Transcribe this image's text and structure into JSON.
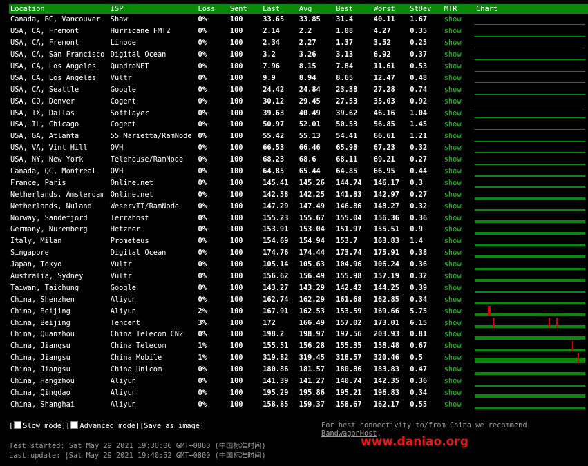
{
  "header": {
    "location": "Location",
    "isp": "ISP",
    "loss": "Loss",
    "sent": "Sent",
    "last": "Last",
    "avg": "Avg",
    "best": "Best",
    "worst": "Worst",
    "stdev": "StDev",
    "mtr": "MTR",
    "chart": "Chart"
  },
  "colors": {
    "header_bg": "#0a8a0a",
    "chart_green": "#0a8a0a",
    "spike_red": "#e00000",
    "link_green": "#1ec81e",
    "watermark": "#e81818"
  },
  "rows": [
    {
      "location": "Canada, BC, Vancouver",
      "isp": "Shaw",
      "loss": "0%",
      "sent": "100",
      "last": "33.65",
      "avg": "33.85",
      "best": "31.4",
      "worst": "40.11",
      "stdev": "1.67",
      "mtr": "show",
      "chart_level": 0.05,
      "spikes": []
    },
    {
      "location": "USA, CA, Fremont",
      "isp": "Hurricane FMT2",
      "loss": "0%",
      "sent": "100",
      "last": "2.14",
      "avg": "2.2",
      "best": "1.08",
      "worst": "4.27",
      "stdev": "0.35",
      "mtr": "show",
      "chart_level": 0.02,
      "spikes": []
    },
    {
      "location": "USA, CA, Fremont",
      "isp": "Linode",
      "loss": "0%",
      "sent": "100",
      "last": "2.34",
      "avg": "2.27",
      "best": "1.37",
      "worst": "3.52",
      "stdev": "0.25",
      "mtr": "show",
      "chart_level": 0.02,
      "spikes": []
    },
    {
      "location": "USA, CA, San Francisco",
      "isp": "Digital Ocean",
      "loss": "0%",
      "sent": "100",
      "last": "3.2",
      "avg": "3.26",
      "best": "3.13",
      "worst": "6.92",
      "stdev": "0.37",
      "mtr": "show",
      "chart_level": 0.02,
      "spikes": []
    },
    {
      "location": "USA, CA, Los Angeles",
      "isp": "QuadraNET",
      "loss": "0%",
      "sent": "100",
      "last": "7.96",
      "avg": "8.15",
      "best": "7.84",
      "worst": "11.61",
      "stdev": "0.53",
      "mtr": "show",
      "chart_level": 0.03,
      "spikes": []
    },
    {
      "location": "USA, CA, Los Angeles",
      "isp": "Vultr",
      "loss": "0%",
      "sent": "100",
      "last": "9.9",
      "avg": "8.94",
      "best": "8.65",
      "worst": "12.47",
      "stdev": "0.48",
      "mtr": "show",
      "chart_level": 0.03,
      "spikes": []
    },
    {
      "location": "USA, CA, Seattle",
      "isp": "Google",
      "loss": "0%",
      "sent": "100",
      "last": "24.42",
      "avg": "24.84",
      "best": "23.38",
      "worst": "27.28",
      "stdev": "0.74",
      "mtr": "show",
      "chart_level": 0.05,
      "spikes": []
    },
    {
      "location": "USA, CO, Denver",
      "isp": "Cogent",
      "loss": "0%",
      "sent": "100",
      "last": "30.12",
      "avg": "29.45",
      "best": "27.53",
      "worst": "35.03",
      "stdev": "0.92",
      "mtr": "show",
      "chart_level": 0.06,
      "spikes": []
    },
    {
      "location": "USA, TX, Dallas",
      "isp": "Softlayer",
      "loss": "0%",
      "sent": "100",
      "last": "39.63",
      "avg": "40.49",
      "best": "39.62",
      "worst": "46.16",
      "stdev": "1.04",
      "mtr": "show",
      "chart_level": 0.08,
      "spikes": []
    },
    {
      "location": "USA, IL, Chicago",
      "isp": "Cogent",
      "loss": "0%",
      "sent": "100",
      "last": "50.97",
      "avg": "52.01",
      "best": "50.53",
      "worst": "56.85",
      "stdev": "1.45",
      "mtr": "show",
      "chart_level": 0.1,
      "spikes": []
    },
    {
      "location": "USA, GA, Atlanta",
      "isp": "55 Marietta/RamNode",
      "loss": "0%",
      "sent": "100",
      "last": "55.42",
      "avg": "55.13",
      "best": "54.41",
      "worst": "66.61",
      "stdev": "1.21",
      "mtr": "show",
      "chart_level": 0.11,
      "spikes": []
    },
    {
      "location": "USA, VA, Vint Hill",
      "isp": "OVH",
      "loss": "0%",
      "sent": "100",
      "last": "66.53",
      "avg": "66.46",
      "best": "65.98",
      "worst": "67.23",
      "stdev": "0.32",
      "mtr": "show",
      "chart_level": 0.13,
      "spikes": []
    },
    {
      "location": "USA, NY, New York",
      "isp": "Telehouse/RamNode",
      "loss": "0%",
      "sent": "100",
      "last": "68.23",
      "avg": "68.6",
      "best": "68.11",
      "worst": "69.21",
      "stdev": "0.27",
      "mtr": "show",
      "chart_level": 0.14,
      "spikes": []
    },
    {
      "location": "Canada, QC, Montreal",
      "isp": "OVH",
      "loss": "0%",
      "sent": "100",
      "last": "64.85",
      "avg": "65.44",
      "best": "64.85",
      "worst": "66.95",
      "stdev": "0.44",
      "mtr": "show",
      "chart_level": 0.13,
      "spikes": []
    },
    {
      "location": "France, Paris",
      "isp": "Online.net",
      "loss": "0%",
      "sent": "100",
      "last": "145.41",
      "avg": "145.26",
      "best": "144.74",
      "worst": "146.17",
      "stdev": "0.3",
      "mtr": "show",
      "chart_level": 0.29,
      "spikes": []
    },
    {
      "location": "Netherlands, Amsterdam",
      "isp": "Online.net",
      "loss": "0%",
      "sent": "100",
      "last": "142.58",
      "avg": "142.25",
      "best": "141.83",
      "worst": "142.97",
      "stdev": "0.27",
      "mtr": "show",
      "chart_level": 0.28,
      "spikes": []
    },
    {
      "location": "Netherlands, Nuland",
      "isp": "WeservIT/RamNode",
      "loss": "0%",
      "sent": "100",
      "last": "147.29",
      "avg": "147.49",
      "best": "146.86",
      "worst": "148.27",
      "stdev": "0.32",
      "mtr": "show",
      "chart_level": 0.29,
      "spikes": []
    },
    {
      "location": "Norway, Sandefjord",
      "isp": "Terrahost",
      "loss": "0%",
      "sent": "100",
      "last": "155.23",
      "avg": "155.67",
      "best": "155.04",
      "worst": "156.36",
      "stdev": "0.36",
      "mtr": "show",
      "chart_level": 0.31,
      "spikes": []
    },
    {
      "location": "Germany, Nuremberg",
      "isp": "Hetzner",
      "loss": "0%",
      "sent": "100",
      "last": "153.91",
      "avg": "153.04",
      "best": "151.97",
      "worst": "155.51",
      "stdev": "0.9",
      "mtr": "show",
      "chart_level": 0.3,
      "spikes": []
    },
    {
      "location": "Italy, Milan",
      "isp": "Prometeus",
      "loss": "0%",
      "sent": "100",
      "last": "154.69",
      "avg": "154.94",
      "best": "153.7",
      "worst": "163.83",
      "stdev": "1.4",
      "mtr": "show",
      "chart_level": 0.31,
      "spikes": []
    },
    {
      "location": "Singapore",
      "isp": "Digital Ocean",
      "loss": "0%",
      "sent": "100",
      "last": "174.76",
      "avg": "174.44",
      "best": "173.74",
      "worst": "175.91",
      "stdev": "0.38",
      "mtr": "show",
      "chart_level": 0.35,
      "spikes": []
    },
    {
      "location": "Japan, Tokyo",
      "isp": "Vultr",
      "loss": "0%",
      "sent": "100",
      "last": "105.14",
      "avg": "105.63",
      "best": "104.96",
      "worst": "106.24",
      "stdev": "0.36",
      "mtr": "show",
      "chart_level": 0.21,
      "spikes": []
    },
    {
      "location": "Australia, Sydney",
      "isp": "Vultr",
      "loss": "0%",
      "sent": "100",
      "last": "156.62",
      "avg": "156.49",
      "best": "155.98",
      "worst": "157.19",
      "stdev": "0.32",
      "mtr": "show",
      "chart_level": 0.31,
      "spikes": []
    },
    {
      "location": "Taiwan, Taichung",
      "isp": "Google",
      "loss": "0%",
      "sent": "100",
      "last": "143.27",
      "avg": "143.29",
      "best": "142.42",
      "worst": "144.25",
      "stdev": "0.39",
      "mtr": "show",
      "chart_level": 0.28,
      "spikes": []
    },
    {
      "location": "China, Shenzhen",
      "isp": "Aliyun",
      "loss": "0%",
      "sent": "100",
      "last": "162.74",
      "avg": "162.29",
      "best": "161.68",
      "worst": "162.85",
      "stdev": "0.34",
      "mtr": "show",
      "chart_level": 0.32,
      "spikes": []
    },
    {
      "location": "China, Beijing",
      "isp": "Aliyun",
      "loss": "2%",
      "sent": "100",
      "last": "167.91",
      "avg": "162.53",
      "best": "153.59",
      "worst": "169.66",
      "stdev": "5.75",
      "mtr": "show",
      "chart_level": 0.32,
      "spikes": [
        0.12,
        0.13
      ]
    },
    {
      "location": "China, Beijing",
      "isp": "Tencent",
      "loss": "3%",
      "sent": "100",
      "last": "172",
      "avg": "166.49",
      "best": "157.02",
      "worst": "173.01",
      "stdev": "6.15",
      "mtr": "show",
      "chart_level": 0.33,
      "spikes": [
        0.16,
        0.67,
        0.74
      ]
    },
    {
      "location": "China, Quanzhou",
      "isp": "China Telecom CN2",
      "loss": "0%",
      "sent": "100",
      "last": "198.2",
      "avg": "198.97",
      "best": "197.56",
      "worst": "203.93",
      "stdev": "0.81",
      "mtr": "show",
      "chart_level": 0.4,
      "spikes": []
    },
    {
      "location": "China, Jiangsu",
      "isp": "China Telecom",
      "loss": "1%",
      "sent": "100",
      "last": "155.51",
      "avg": "156.28",
      "best": "155.35",
      "worst": "158.48",
      "stdev": "0.67",
      "mtr": "show",
      "chart_level": 0.31,
      "spikes": [
        0.88
      ]
    },
    {
      "location": "China, Jiangsu",
      "isp": "China Mobile",
      "loss": "1%",
      "sent": "100",
      "last": "319.82",
      "avg": "319.45",
      "best": "318.57",
      "worst": "320.46",
      "stdev": "0.5",
      "mtr": "show",
      "chart_level": 0.64,
      "spikes": [
        0.93
      ]
    },
    {
      "location": "China, Jiangsu",
      "isp": "China Unicom",
      "loss": "0%",
      "sent": "100",
      "last": "180.86",
      "avg": "181.57",
      "best": "180.86",
      "worst": "183.83",
      "stdev": "0.47",
      "mtr": "show",
      "chart_level": 0.36,
      "spikes": []
    },
    {
      "location": "China, Hangzhou",
      "isp": "Aliyun",
      "loss": "0%",
      "sent": "100",
      "last": "141.39",
      "avg": "141.27",
      "best": "140.74",
      "worst": "142.35",
      "stdev": "0.36",
      "mtr": "show",
      "chart_level": 0.28,
      "spikes": []
    },
    {
      "location": "China, Qingdao",
      "isp": "Aliyun",
      "loss": "0%",
      "sent": "100",
      "last": "195.29",
      "avg": "195.86",
      "best": "195.21",
      "worst": "196.83",
      "stdev": "0.34",
      "mtr": "show",
      "chart_level": 0.39,
      "spikes": []
    },
    {
      "location": "China, Shanghai",
      "isp": "Aliyun",
      "loss": "0%",
      "sent": "100",
      "last": "158.85",
      "avg": "159.37",
      "best": "158.67",
      "worst": "162.17",
      "stdev": "0.55",
      "mtr": "show",
      "chart_level": 0.32,
      "spikes": []
    }
  ],
  "controls": {
    "open_bracket": "[",
    "slow_mode": "Slow mode",
    "mid_bracket": "][",
    "advanced_mode": "Advanced mode",
    "save_image": "Save as image",
    "close_bracket": "]"
  },
  "recommend": {
    "text": "For best connectivity to/from China we recommend ",
    "link": "BandwagonHost",
    "suffix": "."
  },
  "footer": {
    "test_started": "Test started: Sat May 29 2021 19:30:06 GMT+0800 (中国标准时间)",
    "last_update": "Last update: |Sat May 29 2021 19:40:52 GMT+0800 (中国标准时间)"
  },
  "watermark": "www.daniao.org"
}
